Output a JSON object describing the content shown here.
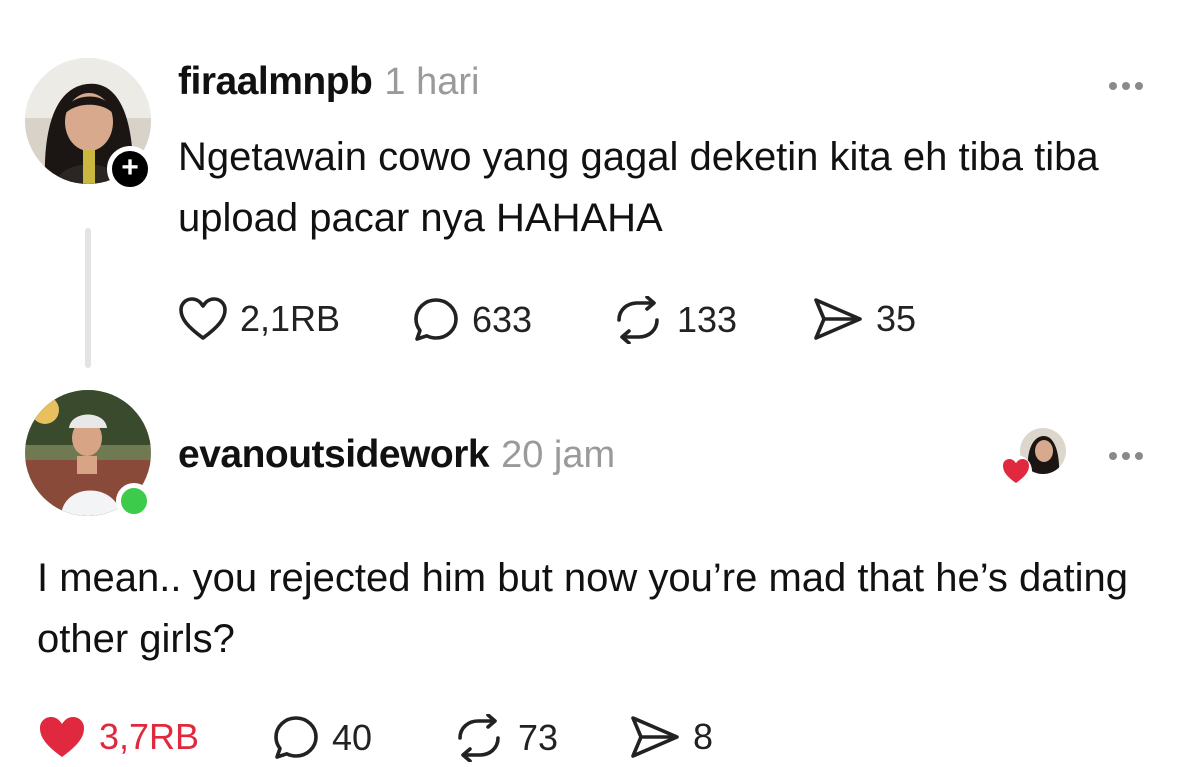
{
  "post": {
    "username": "firaalmnpb",
    "time": "1 hari",
    "text": "Ngetawain cowo yang gagal deketin kita eh tiba tiba upload pacar nya HAHAHA",
    "follow_glyph": "+",
    "actions": {
      "likes": "2,1RB",
      "comments": "633",
      "reposts": "133",
      "shares": "35"
    },
    "liked": false
  },
  "reply": {
    "username": "evanoutsidework",
    "time": "20 jam",
    "text": "I mean.. you rejected him but now you’re mad that he’s dating other girls?",
    "actions": {
      "likes": "3,7RB",
      "comments": "40",
      "reposts": "73",
      "shares": "8"
    },
    "liked": true,
    "liked_by_author": true
  },
  "icons": {
    "like": "heart-outline-icon",
    "like_filled": "heart-filled-icon",
    "comment": "speech-bubble-icon",
    "repost": "repost-arrows-icon",
    "share": "paper-plane-icon",
    "more": "more-dots-icon",
    "follow": "plus-icon",
    "online": "online-dot-icon"
  },
  "colors": {
    "text": "#111111",
    "muted": "#9a9a9a",
    "like_red": "#e0283e",
    "online_green": "#3ccb4a",
    "thread_line": "#e3e3e3"
  }
}
